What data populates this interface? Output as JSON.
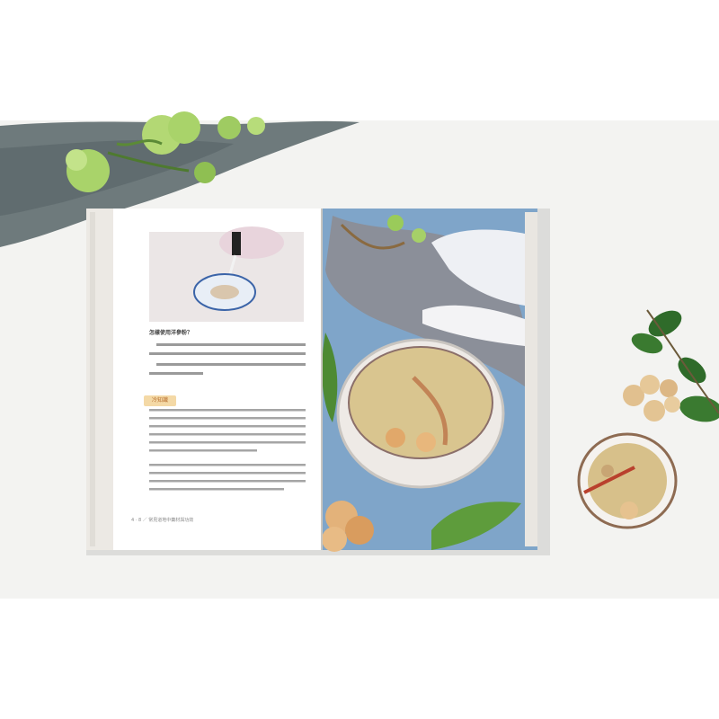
{
  "book": {
    "left_page": {
      "question_title": "怎樣使用洋參粉？",
      "tag_label": "冷知識",
      "footer_text": "4 · 8  ／  常見道地中藥材與功效"
    }
  },
  "colors": {
    "background": "#ffffff",
    "band": "#f3f3f1",
    "cloth": "#6f7a7c",
    "flower": "#a9d36a",
    "wood_blue": "#7fa5c9",
    "tea": "#d7c08a",
    "ginseng_slice": "#e3b27a"
  }
}
